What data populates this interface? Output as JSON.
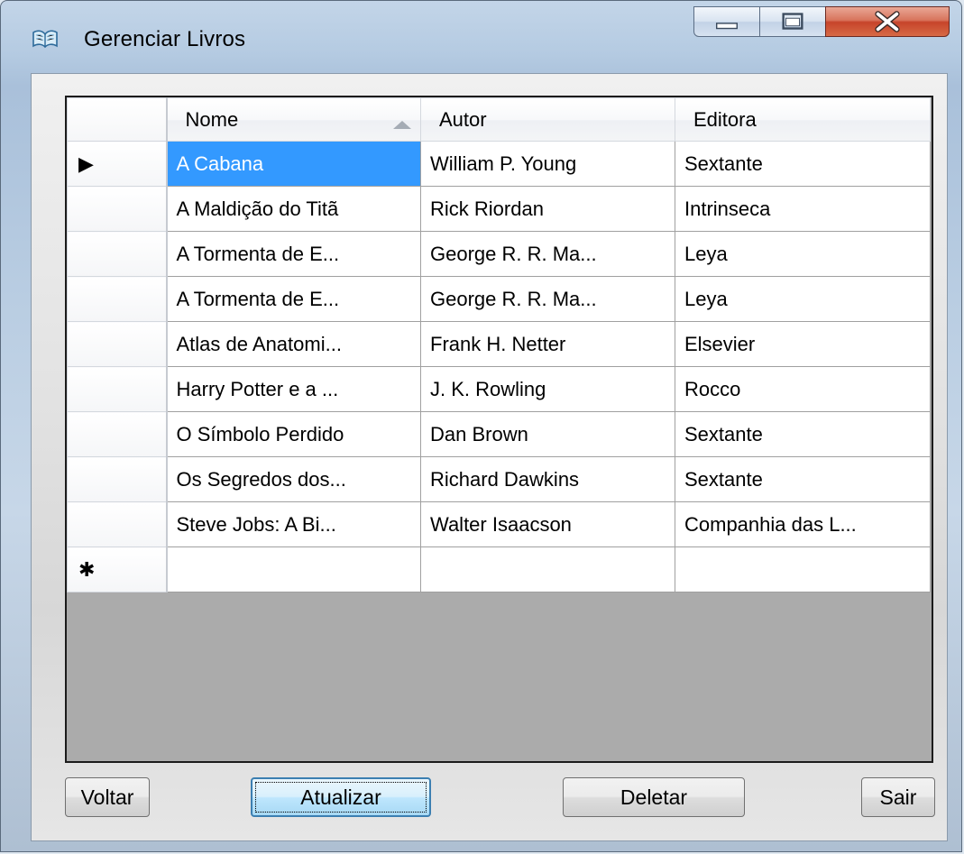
{
  "window": {
    "title": "Gerenciar Livros"
  },
  "grid": {
    "columns": [
      "Nome",
      "Autor",
      "Editora"
    ],
    "sorted_column": "Nome",
    "sort_direction": "ascending",
    "rows": [
      [
        "A Cabana",
        "William P. Young",
        "Sextante"
      ],
      [
        "A Maldição do Titã",
        "Rick Riordan",
        "Intrinseca"
      ],
      [
        "A Tormenta de E...",
        "George R. R. Ma...",
        "Leya"
      ],
      [
        "A Tormenta de E...",
        "George R. R. Ma...",
        "Leya"
      ],
      [
        "Atlas de Anatomi...",
        "Frank H. Netter",
        "Elsevier"
      ],
      [
        "Harry Potter e a ...",
        "J. K. Rowling",
        "Rocco"
      ],
      [
        "O Símbolo Perdido",
        "Dan Brown",
        "Sextante"
      ],
      [
        "Os Segredos dos...",
        "Richard Dawkins",
        "Sextante"
      ],
      [
        "Steve Jobs: A Bi...",
        "Walter Isaacson",
        "Companhia das L..."
      ]
    ],
    "current_row_marker": "▶",
    "new_row_marker": "✱",
    "selected_cell": "A Cabana",
    "selection_color": "#3399ff"
  },
  "buttons": {
    "voltar": "Voltar",
    "atualizar": "Atualizar",
    "deletar": "Deletar",
    "sair": "Sair"
  },
  "icons": {
    "app": "open-book-icon",
    "minimize": "minimize-icon",
    "maximize": "maximize-icon",
    "close": "close-icon"
  }
}
